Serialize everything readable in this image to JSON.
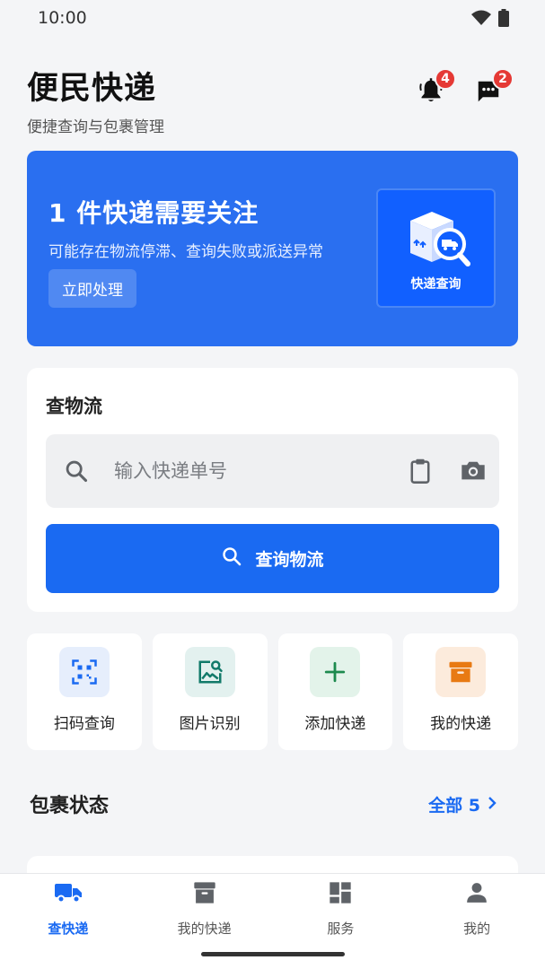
{
  "status_bar": {
    "time": "10:00"
  },
  "header": {
    "title": "便民快递",
    "subtitle": "便捷查询与包裹管理",
    "notifications_count": "4",
    "messages_count": "2"
  },
  "banner": {
    "title": "1 件快递需要关注",
    "description": "可能存在物流停滞、查询失败或派送异常",
    "action_label": "立即处理",
    "image_label": "快递查询"
  },
  "search_card": {
    "title": "查物流",
    "input_value": "",
    "input_placeholder": "输入快递单号",
    "query_label": "查询物流"
  },
  "shortcuts": [
    {
      "label": "扫码查询",
      "icon": "qr-scan-icon",
      "bg": "#e6eefc",
      "color": "#1a6af2"
    },
    {
      "label": "图片识别",
      "icon": "image-search-icon",
      "bg": "#e3f1ef",
      "color": "#127a6a"
    },
    {
      "label": "添加快递",
      "icon": "plus-icon",
      "bg": "#e3f3ea",
      "color": "#1d8a4e"
    },
    {
      "label": "我的快递",
      "icon": "archive-box-icon",
      "bg": "#fcebdc",
      "color": "#e87a13"
    }
  ],
  "package_status": {
    "title": "包裹状态",
    "link_label": "全部 5"
  },
  "tabbar": {
    "items": [
      {
        "label": "查快递",
        "icon": "truck-icon",
        "active": true
      },
      {
        "label": "我的快递",
        "icon": "archive-box-icon",
        "active": false
      },
      {
        "label": "服务",
        "icon": "dashboard-icon",
        "active": false
      },
      {
        "label": "我的",
        "icon": "person-icon",
        "active": false
      }
    ]
  },
  "colors": {
    "primary": "#1a6af2",
    "banner": "#2a6ff0",
    "badge": "#e53935"
  }
}
